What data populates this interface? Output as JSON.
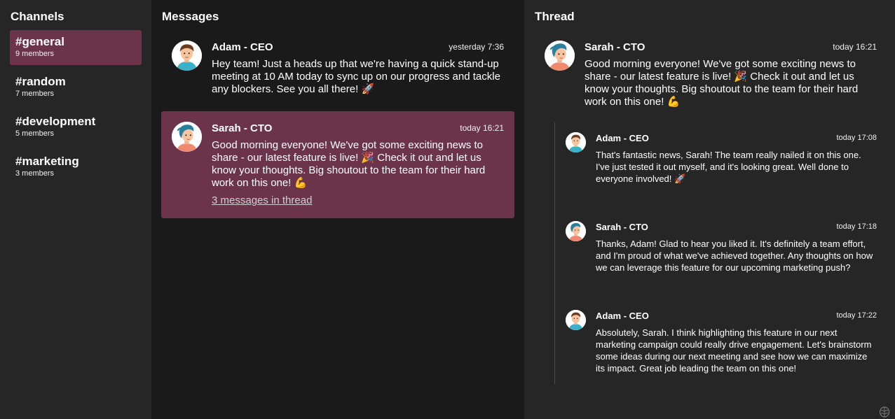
{
  "channels": {
    "title": "Channels",
    "items": [
      {
        "name": "#general",
        "members": "9 members",
        "active": true
      },
      {
        "name": "#random",
        "members": "7 members",
        "active": false
      },
      {
        "name": "#development",
        "members": "5 members",
        "active": false
      },
      {
        "name": "#marketing",
        "members": "3 members",
        "active": false
      }
    ]
  },
  "messages": {
    "title": "Messages",
    "items": [
      {
        "author": "Adam - CEO",
        "time": "yesterday 7:36",
        "text": "Hey team! Just a heads up that we're having a quick stand-up meeting at 10 AM today to sync up on our progress and tackle any blockers. See you all there! 🚀",
        "avatar": "adam-avatar"
      },
      {
        "author": "Sarah - CTO",
        "time": "today 16:21",
        "text": "Good morning everyone! We've got some exciting news to share - our latest feature is live! 🎉 Check it out and let us know your thoughts. Big shoutout to the team for their hard work on this one! 💪",
        "thread_link": "3 messages in thread",
        "avatar": "sarah-avatar"
      }
    ]
  },
  "thread": {
    "title": "Thread",
    "root": {
      "author": "Sarah - CTO",
      "time": "today 16:21",
      "text": "Good morning everyone! We've got some exciting news to share - our latest feature is live! 🎉 Check it out and let us know your thoughts. Big shoutout to the team for their hard work on this one! 💪",
      "avatar": "sarah-avatar"
    },
    "replies": [
      {
        "author": "Adam - CEO",
        "time": "today 17:08",
        "text": "That's fantastic news, Sarah! The team really nailed it on this one. I've just tested it out myself, and it's looking great. Well done to everyone involved! 🚀",
        "avatar": "adam-avatar"
      },
      {
        "author": "Sarah - CTO",
        "time": "today 17:18",
        "text": "Thanks, Adam! Glad to hear you liked it. It's definitely a team effort, and I'm proud of what we've achieved together. Any thoughts on how we can leverage this feature for our upcoming marketing push?",
        "avatar": "sarah-avatar"
      },
      {
        "author": "Adam - CEO",
        "time": "today 17:22",
        "text": "Absolutely, Sarah. I think highlighting this feature in our next marketing campaign could really drive engagement. Let's brainstorm some ideas during our next meeting and see how we can maximize its impact. Great job leading the team on this one!",
        "avatar": "adam-avatar"
      }
    ]
  },
  "colors": {
    "accent": "#6b344a",
    "sidebar_bg": "#262626",
    "main_bg": "#1a1a1a"
  },
  "corner_icon": "brain-icon"
}
